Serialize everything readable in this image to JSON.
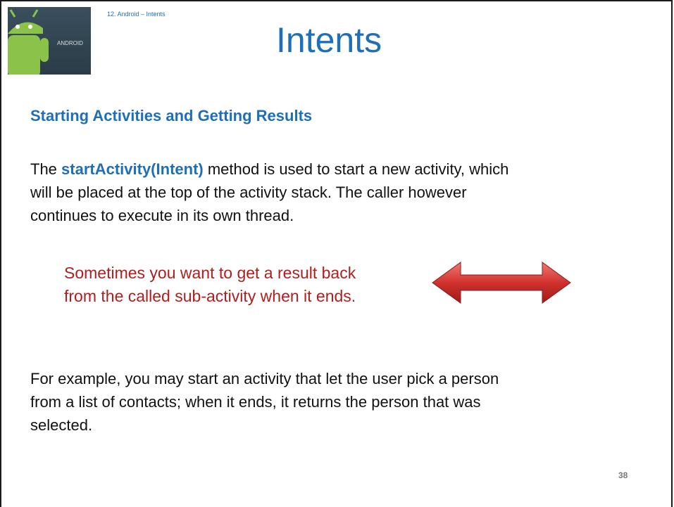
{
  "header": {
    "crumb": "12. Android – Intents",
    "title": "Intents",
    "logo_text": "ANDROID"
  },
  "body": {
    "subheading": "Starting Activities and Getting Results",
    "para1_prefix": "The ",
    "para1_code": "startActivity(Intent)",
    "para1_rest_line1": " method is used to start a new activity, which",
    "para1_line2": "will be placed at the top of the activity stack.  The caller however",
    "para1_line3": "continues to execute in its own thread.",
    "callout_line1": "Sometimes you want to get a result back",
    "callout_line2": "from the called sub-activity when it ends.",
    "para2_line1": "For example, you may start an activity that let the user pick a person",
    "para2_line2": "from a list of contacts; when it ends, it returns the person that was",
    "para2_line3": "selected."
  },
  "footer": {
    "page_number": "38"
  },
  "colors": {
    "accent_blue": "#1f6fb8",
    "callout_red": "#b01e1e",
    "arrow_red": "#d0312d"
  },
  "icons": [
    "android-logo",
    "double-arrow-icon"
  ]
}
